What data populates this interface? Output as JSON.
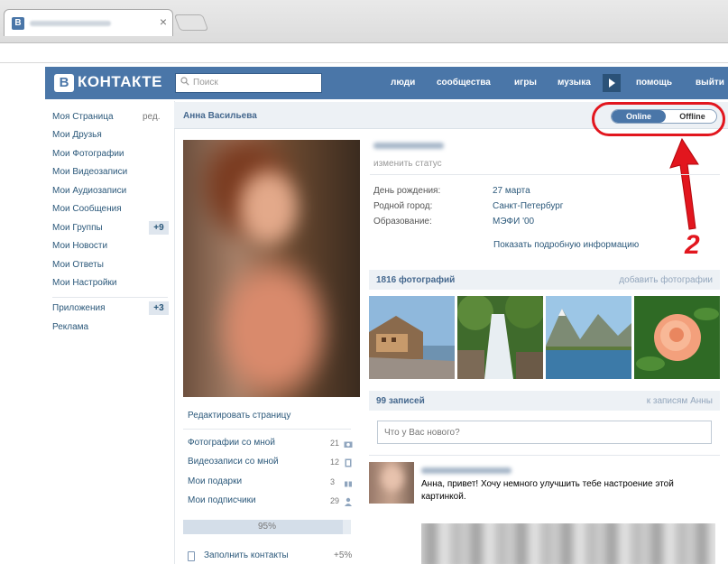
{
  "browser": {
    "tab_favicon": "В",
    "tab_close": "×"
  },
  "header": {
    "logo_letter": "В",
    "logo_text": "КОНТАКТЕ",
    "search_placeholder": "Поиск",
    "nav": [
      "люди",
      "сообщества",
      "игры",
      "музыка",
      "помощь",
      "выйти"
    ]
  },
  "sidebar": {
    "edit_label": "ред.",
    "items": [
      "Моя Страница",
      "Мои Друзья",
      "Мои Фотографии",
      "Мои Видеозаписи",
      "Мои Аудиозаписи",
      "Мои Сообщения",
      "Мои Группы",
      "Мои Новости",
      "Мои Ответы",
      "Мои Настройки",
      "Приложения",
      "Реклама"
    ],
    "groups_badge": "+9",
    "apps_badge": "+3"
  },
  "profile": {
    "name": "Анна Васильева",
    "toggle_online": "Online",
    "toggle_offline": "Offline",
    "change_status": "изменить статус",
    "birthday_label": "День рождения:",
    "birthday_value": "27 марта",
    "city_label": "Родной город:",
    "city_value": "Санкт-Петербург",
    "education_label": "Образование:",
    "education_value": "МЭФИ '00",
    "more_info": "Показать подробную информацию"
  },
  "left_column": {
    "edit_page": "Редактировать страницу",
    "rows": [
      {
        "label": "Фотографии со мной",
        "count": "21"
      },
      {
        "label": "Видеозаписи со мной",
        "count": "12"
      },
      {
        "label": "Мои подарки",
        "count": "3"
      },
      {
        "label": "Мои подписчики",
        "count": "29"
      }
    ],
    "progress_label": "95%",
    "progress_value": 95,
    "fill_contacts": "Заполнить контакты",
    "fill_contacts_pct": "+5%"
  },
  "photos": {
    "title": "1816 фотографий",
    "action": "добавить фотографии"
  },
  "wall": {
    "title": "99 записей",
    "action": "к записям Анны",
    "input_placeholder": "Что у Вас нового?",
    "post_text": "Анна, привет! Хочу немного улучшить тебе настроение этой картинкой."
  },
  "annotation": {
    "number": "2",
    "color": "#e2161e"
  },
  "colors": {
    "brand": "#4a76a8",
    "link": "#2b587a"
  }
}
